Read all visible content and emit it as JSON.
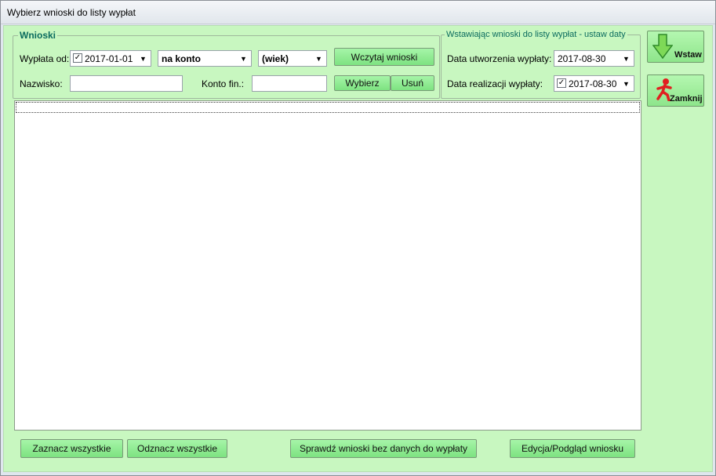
{
  "window": {
    "title": "Wybierz wnioski do listy wypłat"
  },
  "wnioski": {
    "legend": "Wnioski",
    "wyplata_od_label": "Wypłata od:",
    "wyplata_od_checked": "✓",
    "wyplata_od_date": "2017-01-01",
    "typ_wyplaty": "na konto",
    "wiek": "(wiek)",
    "wczytaj_label": "Wczytaj wnioski",
    "nazwisko_label": "Nazwisko:",
    "nazwisko_value": "",
    "konto_label": "Konto fin.:",
    "konto_value": "",
    "wybierz_label": "Wybierz",
    "usun_label": "Usuń"
  },
  "daty": {
    "legend": "Wstawiając wnioski do listy wypłat - ustaw daty",
    "utworzenia_label": "Data utworzenia wypłaty:",
    "utworzenia_value": "2017-08-30",
    "realizacji_label": "Data realizacji wypłaty:",
    "realizacji_checked": "✓",
    "realizacji_value": "2017-08-30"
  },
  "side": {
    "wstaw_label": "Wstaw",
    "zamknij_label": "Zamknij"
  },
  "bottom": {
    "zaznacz_label": "Zaznacz wszystkie",
    "odznacz_label": "Odznacz wszystkie",
    "sprawdz_label": "Sprawdź wnioski bez danych do wypłaty",
    "edycja_label": "Edycja/Podgląd wniosku"
  },
  "colors": {
    "client_bg": "#c8f7c0",
    "button": "#8ee58b",
    "legend_text": "#0a6b5e"
  }
}
